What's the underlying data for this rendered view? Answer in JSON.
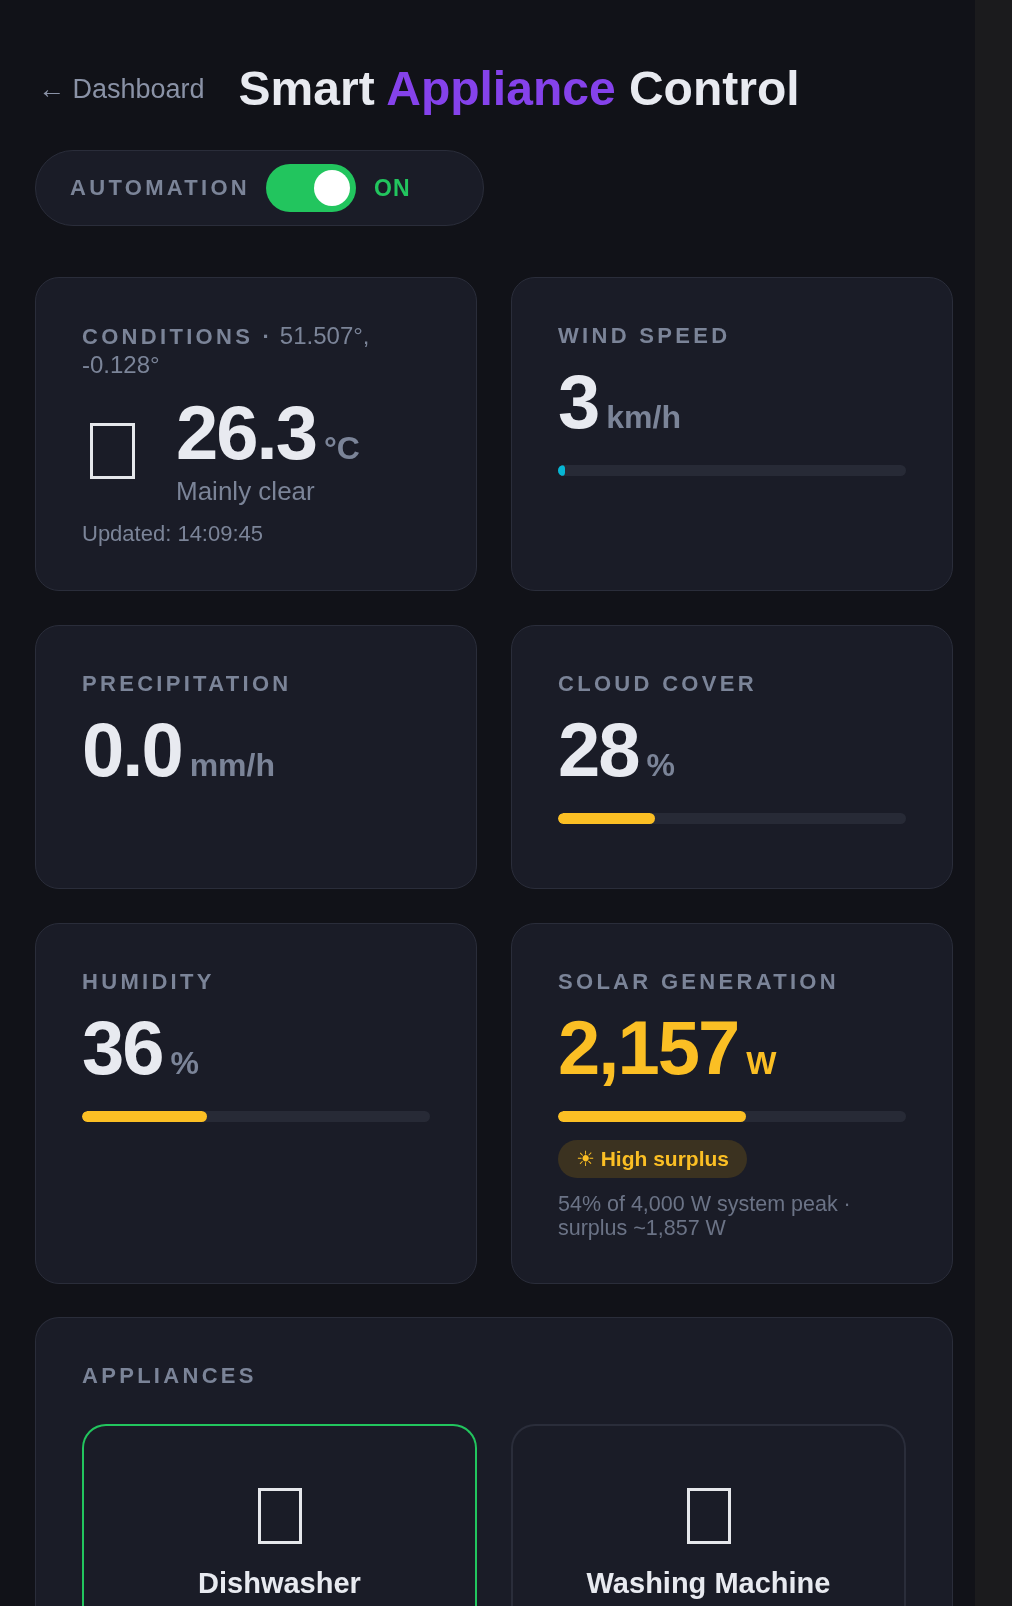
{
  "header": {
    "back_link": "← Dashboard",
    "title": {
      "before": "Smart",
      "highlight": "Appliance",
      "after": "Control"
    }
  },
  "automation": {
    "label": "AUTOMATION",
    "on": true,
    "state_text": "ON"
  },
  "metrics": [
    {
      "kind": "conditions",
      "label": "**CONDITIONS ·** 51.507°, -0.128°",
      "value": "26.3",
      "unit": "°C",
      "description": "Mainly clear",
      "updated": "Updated: 14:09:45"
    },
    {
      "kind": "metric",
      "label": "WIND SPEED",
      "value": "3",
      "unit": "km/h",
      "bar": {
        "level": 0.02,
        "color": "#06b6d4"
      }
    },
    {
      "kind": "metric",
      "label": "PRECIPITATION",
      "value": "0.0",
      "unit": "mm/h"
    },
    {
      "kind": "metric",
      "label": "CLOUD COVER",
      "value": "28",
      "unit": "%",
      "bar": {
        "level": 0.28,
        "color": "#fbbf24"
      }
    },
    {
      "kind": "metric",
      "label": "HUMIDITY",
      "value": "36",
      "unit": "%",
      "bar": {
        "level": 0.36,
        "color": "#fbbf24"
      }
    },
    {
      "kind": "solar",
      "label": "SOLAR GENERATION",
      "value": "2,157",
      "unit": "W",
      "bar": {
        "level": 0.54,
        "color": "#fbbf24"
      },
      "badge": "☀ High surplus",
      "note": "54% of 4,000 W system peak · surplus ~1,857 W"
    }
  ],
  "appliances": {
    "label": "APPLIANCES",
    "items": [
      {
        "name": "Dishwasher",
        "on": true
      },
      {
        "name": "Washing Machine",
        "on": false
      }
    ]
  }
}
